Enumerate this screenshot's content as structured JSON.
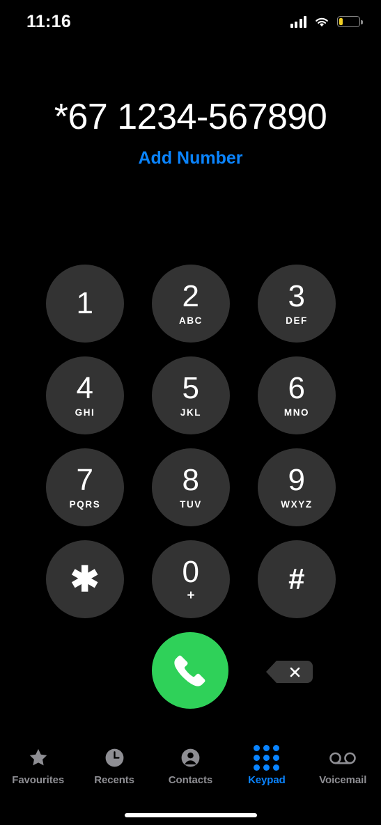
{
  "status_bar": {
    "time": "11:16",
    "signal_icon": "cellular-signal-icon",
    "signal_bars": 4,
    "wifi_icon": "wifi-icon",
    "battery_icon": "battery-icon",
    "battery_level_percent": 20,
    "battery_color": "#f2d024"
  },
  "display": {
    "dialed_number": "*67 1234-567890",
    "add_number_label": "Add Number",
    "accent_color": "#0a84ff"
  },
  "keypad": {
    "keys": [
      {
        "digit": "1",
        "letters": ""
      },
      {
        "digit": "2",
        "letters": "ABC"
      },
      {
        "digit": "3",
        "letters": "DEF"
      },
      {
        "digit": "4",
        "letters": "GHI"
      },
      {
        "digit": "5",
        "letters": "JKL"
      },
      {
        "digit": "6",
        "letters": "MNO"
      },
      {
        "digit": "7",
        "letters": "PQRS"
      },
      {
        "digit": "8",
        "letters": "TUV"
      },
      {
        "digit": "9",
        "letters": "WXYZ"
      },
      {
        "digit": "✱",
        "letters": ""
      },
      {
        "digit": "0",
        "letters": "+"
      },
      {
        "digit": "#",
        "letters": ""
      }
    ],
    "key_color": "#333333"
  },
  "actions": {
    "call_icon": "phone-handset-icon",
    "call_color": "#2fd159",
    "delete_icon": "backspace-delete-icon",
    "delete_color": "#3a3a3a"
  },
  "tab_bar": {
    "items": [
      {
        "label": "Favourites",
        "icon": "star-icon",
        "active": false
      },
      {
        "label": "Recents",
        "icon": "clock-icon",
        "active": false
      },
      {
        "label": "Contacts",
        "icon": "person-circle-icon",
        "active": false
      },
      {
        "label": "Keypad",
        "icon": "keypad-dots-icon",
        "active": true
      },
      {
        "label": "Voicemail",
        "icon": "voicemail-tape-icon",
        "active": false
      }
    ],
    "inactive_color": "#8e8e93",
    "active_color": "#0a84ff"
  }
}
